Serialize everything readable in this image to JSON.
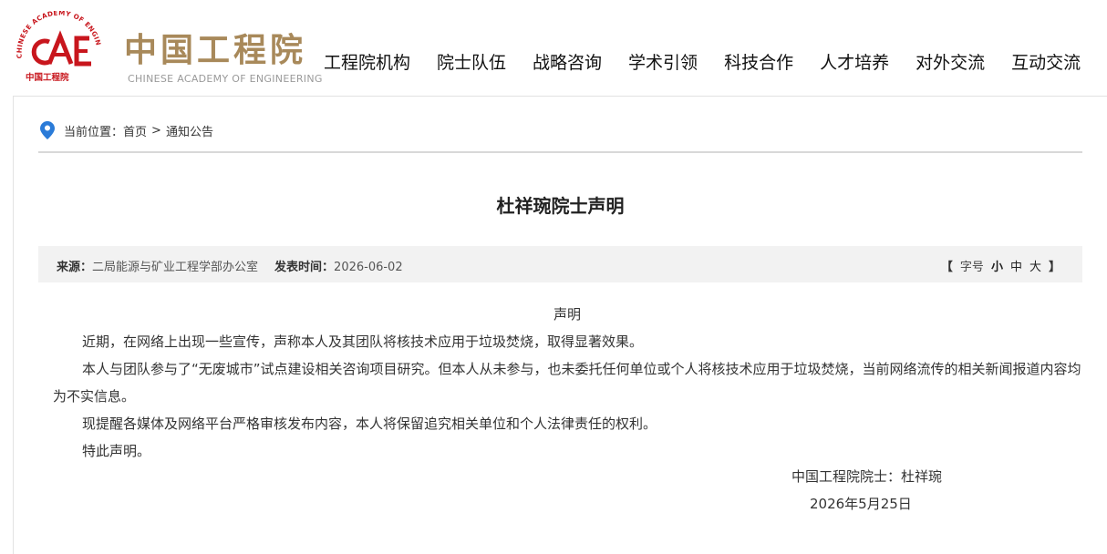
{
  "header": {
    "logo": {
      "emblem_text": "CHINESE ACADEMY OF ENGINEERING",
      "emblem_caption": "中国工程院",
      "cn_name": "中国工程院",
      "en_name": "CHINESE ACADEMY OF ENGINEERING"
    },
    "nav": [
      "工程院机构",
      "院士队伍",
      "战略咨询",
      "学术引领",
      "科技合作",
      "人才培养",
      "对外交流",
      "互动交流"
    ]
  },
  "breadcrumb": {
    "icon": "location-pin-icon",
    "prefix": "当前位置：",
    "home": "首页",
    "separator": ">",
    "current": "通知公告"
  },
  "article": {
    "title": "杜祥琬院士声明",
    "meta": {
      "source_label": "来源：",
      "source_value": "二局能源与矿业工程学部办公室",
      "date_label": "发表时间：",
      "date_value": "2026-06-02",
      "bracket_open": "【",
      "font_label": "字号",
      "font_sizes": [
        "小",
        "中",
        "大"
      ],
      "bracket_close": "】"
    },
    "heading": "声明",
    "paragraphs": [
      "近期，在网络上出现一些宣传，声称本人及其团队将核技术应用于垃圾焚烧，取得显著效果。",
      "本人与团队参与了“无废城市”试点建设相关咨询项目研究。但本人从未参与，也未委托任何单位或个人将核技术应用于垃圾焚烧，当前网络流传的相关新闻报道内容均为不实信息。",
      "现提醒各媒体及网络平台严格审核发布内容，本人将保留追究相关单位和个人法律责任的权利。",
      "特此声明。"
    ],
    "signature": "中国工程院院士：杜祥琬",
    "sign_date": "2026年5月25日"
  },
  "colors": {
    "logo_red": "#c8161d",
    "logo_gold": "#a8895a",
    "pin_blue": "#2a7bd8"
  }
}
